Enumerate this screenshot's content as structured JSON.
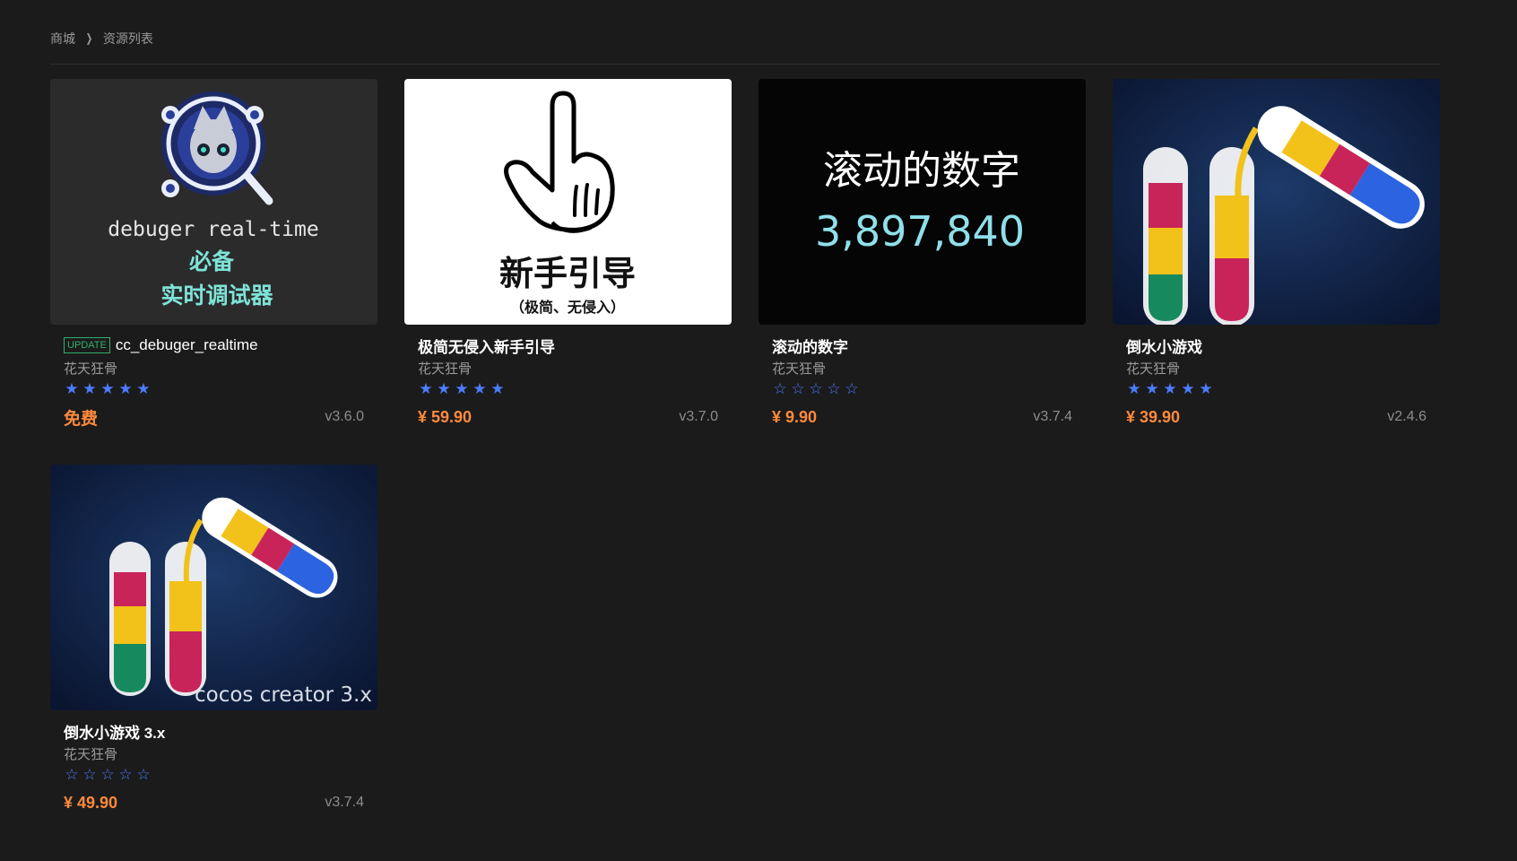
{
  "breadcrumb": {
    "home": "商城",
    "current": "资源列表"
  },
  "colors": {
    "accent_price": "#ff8a3d",
    "star": "#4c7cff",
    "badge": "#2fb06d",
    "background": "#1b1b1b"
  },
  "items": [
    {
      "badge": "UPDATE",
      "title": "cc_debuger_realtime",
      "author": "花天狂骨",
      "rating": 5,
      "price": "免费",
      "version": "v3.6.0",
      "thumb": {
        "line1": "debuger real-time",
        "line2": "必备",
        "line3": "实时调试器"
      }
    },
    {
      "title": "极简无侵入新手引导",
      "author": "花天狂骨",
      "rating": 5,
      "price": "¥ 59.90",
      "version": "v3.7.0",
      "thumb": {
        "line1": "新手引导",
        "line2": "（极简、无侵入）"
      }
    },
    {
      "title": "滚动的数字",
      "author": "花天狂骨",
      "rating": 0,
      "price": "¥ 9.90",
      "version": "v3.7.4",
      "thumb": {
        "line1": "滚动的数字",
        "line2": "3,897,840"
      }
    },
    {
      "title": "倒水小游戏",
      "author": "花天狂骨",
      "rating": 5,
      "price": "¥ 39.90",
      "version": "v2.4.6"
    },
    {
      "title": "倒水小游戏 3.x",
      "author": "花天狂骨",
      "rating": 0,
      "price": "¥ 49.90",
      "version": "v3.7.4",
      "thumb": {
        "caption": "cocos creator 3.x"
      }
    }
  ]
}
